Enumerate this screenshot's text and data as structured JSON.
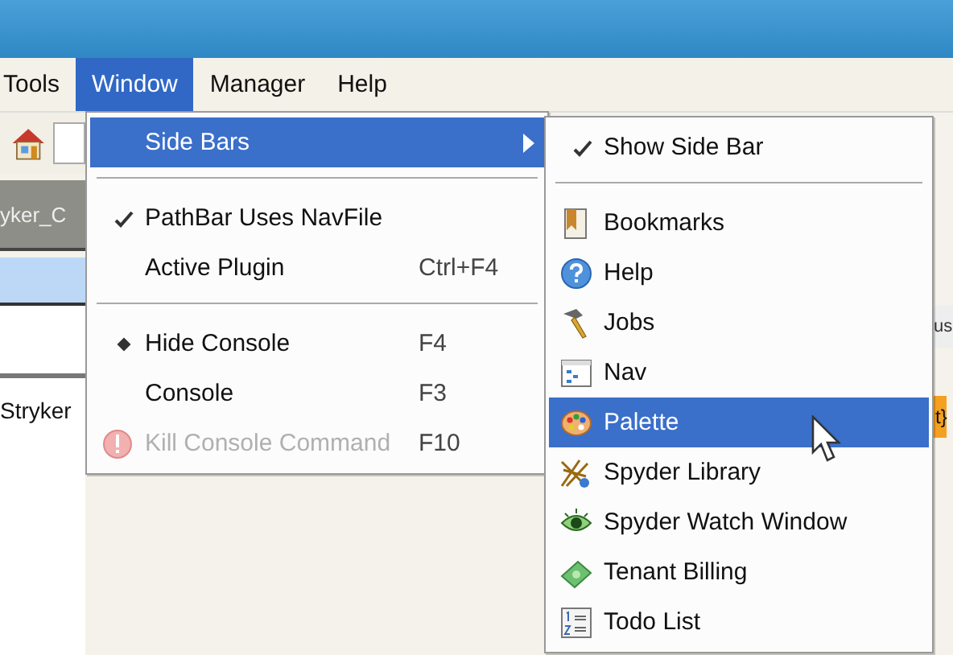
{
  "menubar": [
    {
      "label": "Tools",
      "selected": false
    },
    {
      "label": "Window",
      "selected": true
    },
    {
      "label": "Manager",
      "selected": false
    },
    {
      "label": "Help",
      "selected": false
    }
  ],
  "backdrop": {
    "tab": "yker_C",
    "tree_item": "Stryker",
    "column_header": "us",
    "status_cell": "t}"
  },
  "window_menu": [
    {
      "kind": "item",
      "label": "Side Bars",
      "submenu": true,
      "selected": true,
      "disabled": false
    },
    {
      "kind": "separator"
    },
    {
      "kind": "check",
      "label": "PathBar Uses NavFile",
      "checked": true,
      "selected": false,
      "disabled": false
    },
    {
      "kind": "item",
      "label": "Active Plugin",
      "shortcut": "Ctrl+F4",
      "submenu": false,
      "selected": false,
      "disabled": false
    },
    {
      "kind": "separator"
    },
    {
      "kind": "radio",
      "label": "Hide Console",
      "shortcut": "F4",
      "checked": true,
      "selected": false,
      "disabled": false
    },
    {
      "kind": "item",
      "label": "Console",
      "shortcut": "F3",
      "submenu": false,
      "selected": false,
      "disabled": false
    },
    {
      "kind": "item",
      "label": "Kill Console Command",
      "shortcut": "F10",
      "submenu": false,
      "selected": false,
      "disabled": true
    }
  ],
  "side_bars_menu": [
    {
      "kind": "check",
      "label": "Show Side Bar",
      "checked": true,
      "selected": false
    },
    {
      "kind": "separator"
    },
    {
      "kind": "icon",
      "label": "Bookmarks",
      "selected": false
    },
    {
      "kind": "icon",
      "label": "Help",
      "selected": false
    },
    {
      "kind": "icon",
      "label": "Jobs",
      "selected": false
    },
    {
      "kind": "icon",
      "label": "Nav",
      "selected": false
    },
    {
      "kind": "icon",
      "label": "Palette",
      "selected": true
    },
    {
      "kind": "icon",
      "label": "Spyder Library",
      "selected": false
    },
    {
      "kind": "icon",
      "label": "Spyder Watch Window",
      "selected": false
    },
    {
      "kind": "icon",
      "label": "Tenant Billing",
      "selected": false
    },
    {
      "kind": "icon",
      "label": "Todo List",
      "selected": false
    }
  ]
}
